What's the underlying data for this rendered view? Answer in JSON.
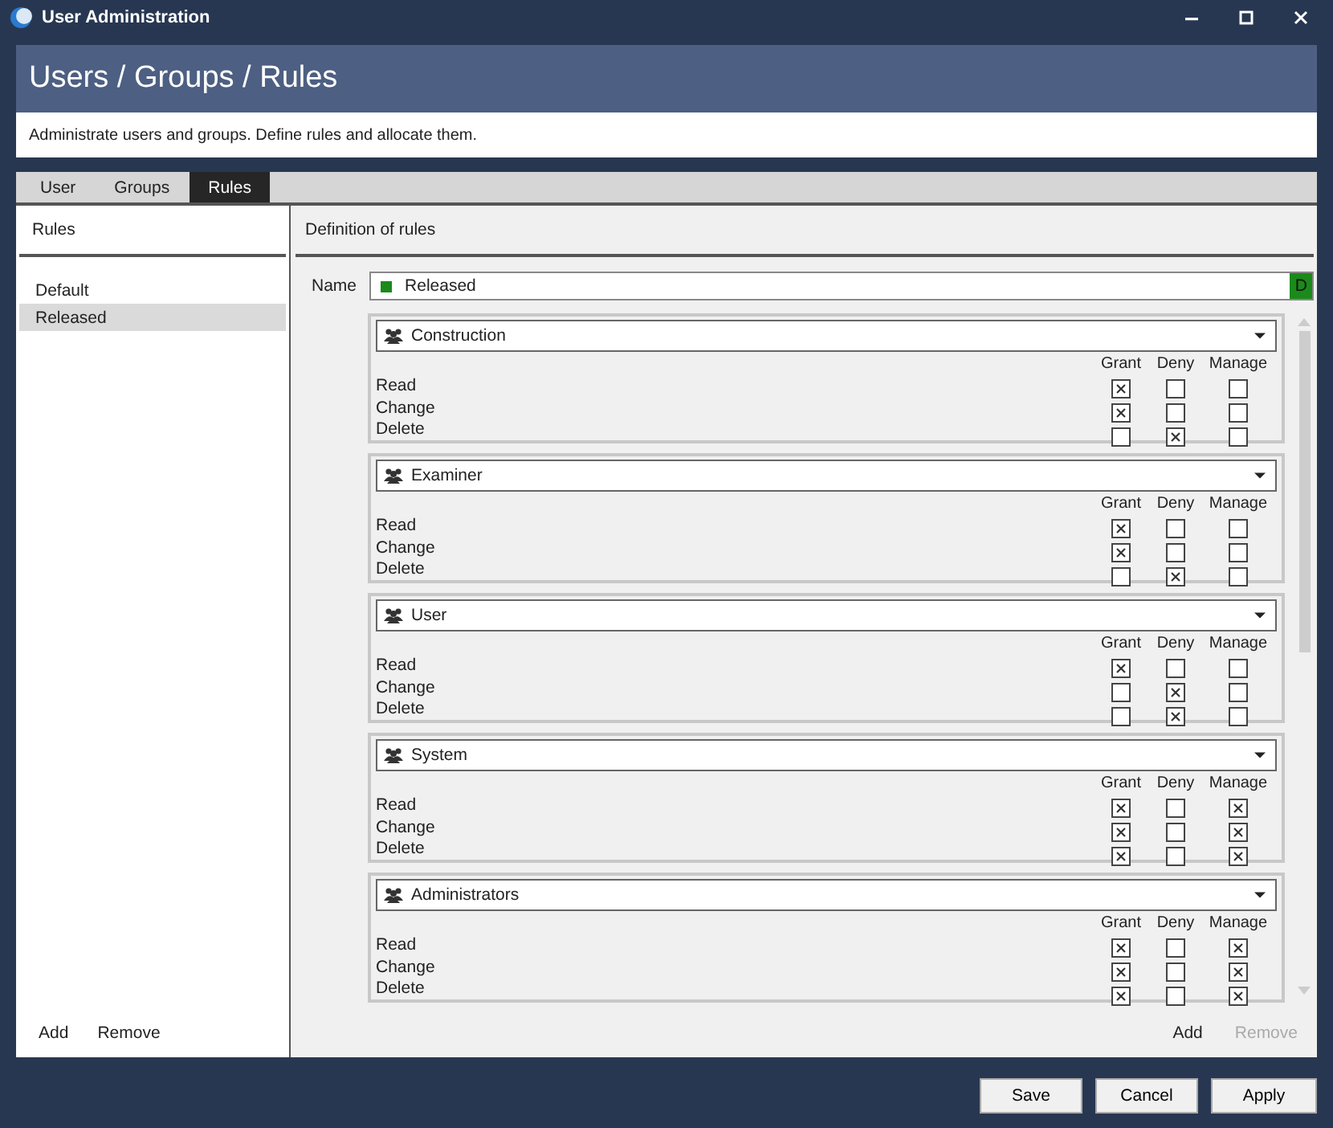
{
  "window": {
    "title": "User Administration"
  },
  "header": {
    "title": "Users / Groups / Rules",
    "description": "Administrate users and groups. Define rules and allocate them."
  },
  "tabs": [
    {
      "label": "User",
      "selected": false
    },
    {
      "label": "Groups",
      "selected": false
    },
    {
      "label": "Rules",
      "selected": true
    }
  ],
  "rules_panel": {
    "title": "Rules",
    "items": [
      {
        "label": "Default",
        "selected": false
      },
      {
        "label": "Released",
        "selected": true
      }
    ],
    "actions": [
      {
        "label": "Add",
        "disabled": false
      },
      {
        "label": "Remove",
        "disabled": false
      }
    ]
  },
  "definition": {
    "title": "Definition of rules",
    "name_label": "Name",
    "name_field": {
      "value": "Released",
      "color": "#1a8a1a"
    },
    "badge": "D",
    "groups": [
      {
        "group": "Construction",
        "columns": [
          "Grant",
          "Deny",
          "Manage"
        ],
        "rows": [
          {
            "label": "Read",
            "grant": true,
            "deny": false,
            "manage": false
          },
          {
            "label": "Change",
            "grant": true,
            "deny": false,
            "manage": false
          },
          {
            "label": "Delete",
            "grant": false,
            "deny": true,
            "manage": false
          }
        ]
      },
      {
        "group": "Examiner",
        "columns": [
          "Grant",
          "Deny",
          "Manage"
        ],
        "rows": [
          {
            "label": "Read",
            "grant": true,
            "deny": false,
            "manage": false
          },
          {
            "label": "Change",
            "grant": true,
            "deny": false,
            "manage": false
          },
          {
            "label": "Delete",
            "grant": false,
            "deny": true,
            "manage": false
          }
        ]
      },
      {
        "group": "User",
        "columns": [
          "Grant",
          "Deny",
          "Manage"
        ],
        "rows": [
          {
            "label": "Read",
            "grant": true,
            "deny": false,
            "manage": false
          },
          {
            "label": "Change",
            "grant": false,
            "deny": true,
            "manage": false
          },
          {
            "label": "Delete",
            "grant": false,
            "deny": true,
            "manage": false
          }
        ]
      },
      {
        "group": "System",
        "columns": [
          "Grant",
          "Deny",
          "Manage"
        ],
        "rows": [
          {
            "label": "Read",
            "grant": true,
            "deny": false,
            "manage": true
          },
          {
            "label": "Change",
            "grant": true,
            "deny": false,
            "manage": true
          },
          {
            "label": "Delete",
            "grant": true,
            "deny": false,
            "manage": true
          }
        ]
      },
      {
        "group": "Administrators",
        "columns": [
          "Grant",
          "Deny",
          "Manage"
        ],
        "rows": [
          {
            "label": "Read",
            "grant": true,
            "deny": false,
            "manage": true
          },
          {
            "label": "Change",
            "grant": true,
            "deny": false,
            "manage": true
          },
          {
            "label": "Delete",
            "grant": true,
            "deny": false,
            "manage": true
          }
        ]
      }
    ],
    "actions": [
      {
        "label": "Add",
        "disabled": false
      },
      {
        "label": "Remove",
        "disabled": true
      }
    ]
  },
  "buttons": [
    "Save",
    "Cancel",
    "Apply"
  ]
}
